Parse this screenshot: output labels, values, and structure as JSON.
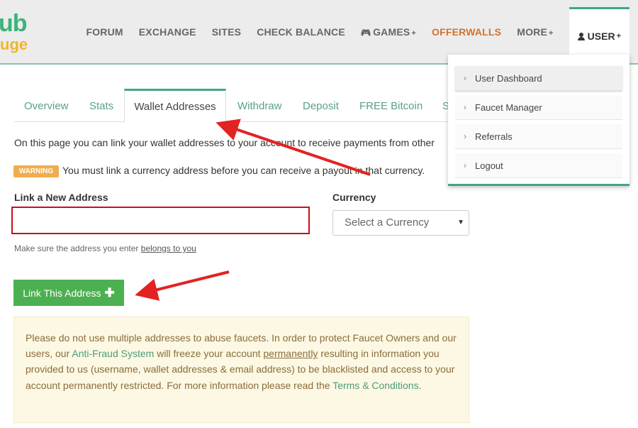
{
  "logo": {
    "line1": "ub",
    "line2": "uge"
  },
  "nav": {
    "items": [
      "FORUM",
      "EXCHANGE",
      "SITES",
      "CHECK BALANCE"
    ],
    "games": "GAMES",
    "offerwalls": "OFFERWALLS",
    "more": "MORE",
    "user": "USER",
    "plus": "+"
  },
  "dropdown": {
    "items": [
      "User Dashboard",
      "Faucet Manager",
      "Referrals",
      "Logout"
    ],
    "chevron": "›"
  },
  "tabs": [
    "Overview",
    "Stats",
    "Wallet Addresses",
    "Withdraw",
    "Deposit",
    "FREE Bitcoin",
    "S"
  ],
  "intro": "On this page you can link your wallet addresses to your account to receive payments from other",
  "warning": {
    "badge": "WARNING",
    "text": "You must link a currency address before you can receive a payout in that currency."
  },
  "form": {
    "address_label": "Link a New Address",
    "address_value": "",
    "currency_label": "Currency",
    "currency_selected": "Select a Currency",
    "select_arrow": "▼",
    "hint_prefix": "Make sure the address you enter ",
    "hint_link": "belongs to you",
    "button_label": "Link This Address",
    "button_icon": "✚"
  },
  "notice": {
    "part1": "Please do not use multiple addresses to abuse faucets. In order to protect Faucet Owners and our users, our ",
    "anti_fraud": "Anti-Fraud System",
    "part2": " will freeze your account ",
    "permanently": "permanently",
    "part3": " resulting in information you provided to us (username, wallet addresses & email address) to be blacklisted and access to your account permanently restricted. For more information please read the ",
    "terms": "Terms & Conditions",
    "part4": "."
  },
  "colors": {
    "brand_green": "#3ea882",
    "button_green": "#4caf50",
    "warning_orange": "#f0ad4e",
    "offerwalls_orange": "#d2722c",
    "highlight_red": "#c9101a",
    "arrow_red": "#e32222",
    "notice_bg": "#fcf8e3"
  }
}
